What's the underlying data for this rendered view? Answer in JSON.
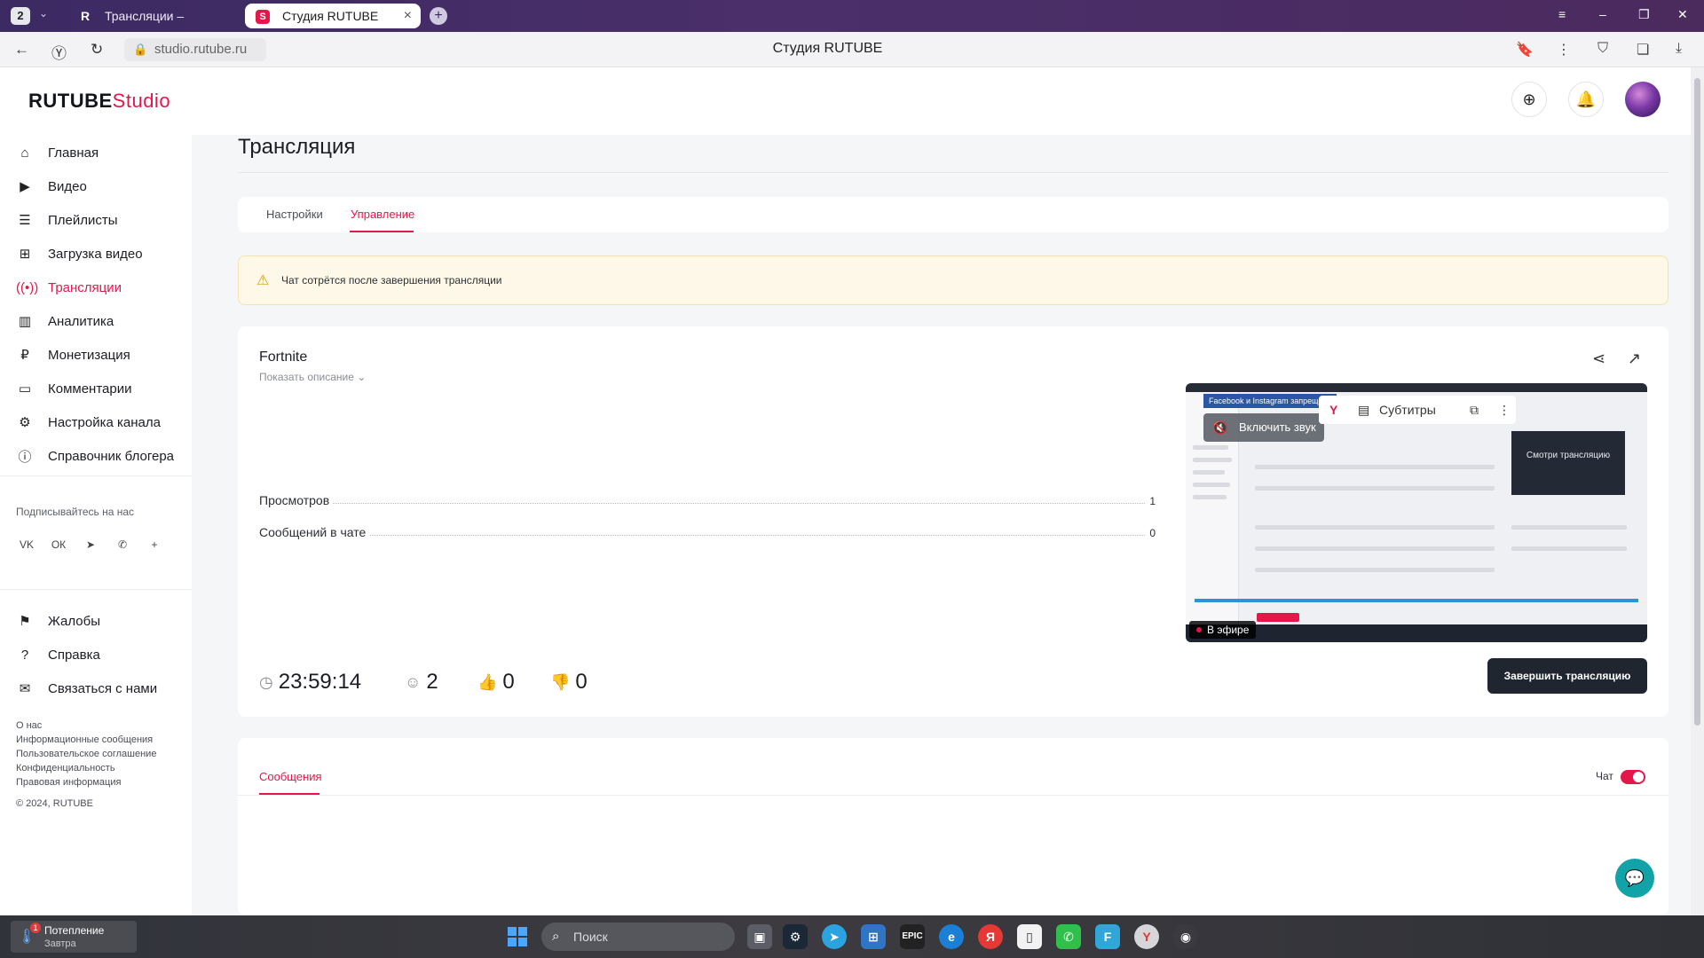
{
  "browser": {
    "tab_count": "2",
    "tab1_title": "Трансляции – смотреть в",
    "tab2_title": "Студия RUTUBE",
    "url": "studio.rutube.ru",
    "page_title": "Студия RUTUBE"
  },
  "header": {
    "logo_main": "RUTUBE",
    "logo_studio": "Studio"
  },
  "sidebar": {
    "items": [
      {
        "label": "Главная",
        "icon": "home-icon"
      },
      {
        "label": "Видео",
        "icon": "video-icon"
      },
      {
        "label": "Плейлисты",
        "icon": "playlist-icon"
      },
      {
        "label": "Загрузка видео",
        "icon": "upload-icon"
      },
      {
        "label": "Трансляции",
        "icon": "broadcast-icon"
      },
      {
        "label": "Аналитика",
        "icon": "analytics-icon"
      },
      {
        "label": "Монетизация",
        "icon": "ruble-icon"
      },
      {
        "label": "Комментарии",
        "icon": "comment-icon"
      },
      {
        "label": "Настройка канала",
        "icon": "gear-icon"
      },
      {
        "label": "Справочник блогера",
        "icon": "info-icon"
      }
    ],
    "subscribe_label": "Подписывайтесь на нас",
    "bottom_items": [
      {
        "label": "Жалобы",
        "icon": "flag-icon"
      },
      {
        "label": "Справка",
        "icon": "help-icon"
      },
      {
        "label": "Связаться с нами",
        "icon": "mail-icon"
      }
    ],
    "footer_links": [
      "О нас",
      "Информационные сообщения",
      "Пользовательское соглашение",
      "Конфиденциальность",
      "Правовая информация"
    ],
    "copyright": "© 2024, RUTUBE"
  },
  "main": {
    "title": "Трансляция",
    "tabs": [
      {
        "label": "Настройки",
        "active": false
      },
      {
        "label": "Управление",
        "active": true
      }
    ],
    "alert": "Чат сотрётся после завершения трансляции",
    "stream": {
      "title": "Fortnite",
      "show_description": "Показать описание",
      "stats": [
        {
          "label": "Просмотров",
          "value": "1"
        },
        {
          "label": "Сообщений в чате",
          "value": "0"
        }
      ],
      "duration": "23:59:14",
      "viewers": "2",
      "likes": "0",
      "dislikes": "0",
      "end_button": "Завершить трансляцию"
    },
    "preview": {
      "unmute": "Включить звук",
      "subtitles": "Субтитры",
      "live_badge": "В эфире",
      "banner": "Facebook и Instagram запрещены",
      "inner_box": "Смотри трансляцию"
    },
    "messages_tab": "Сообщения",
    "chat_label": "Чат",
    "chat_enabled": true
  },
  "taskbar": {
    "weather_title": "Потепление",
    "weather_sub": "Завтра",
    "weather_badge": "1",
    "search_placeholder": "Поиск"
  },
  "colors": {
    "accent": "#e5174a",
    "dark_button": "#1f2630",
    "alert_bg": "#fdf8e8"
  }
}
